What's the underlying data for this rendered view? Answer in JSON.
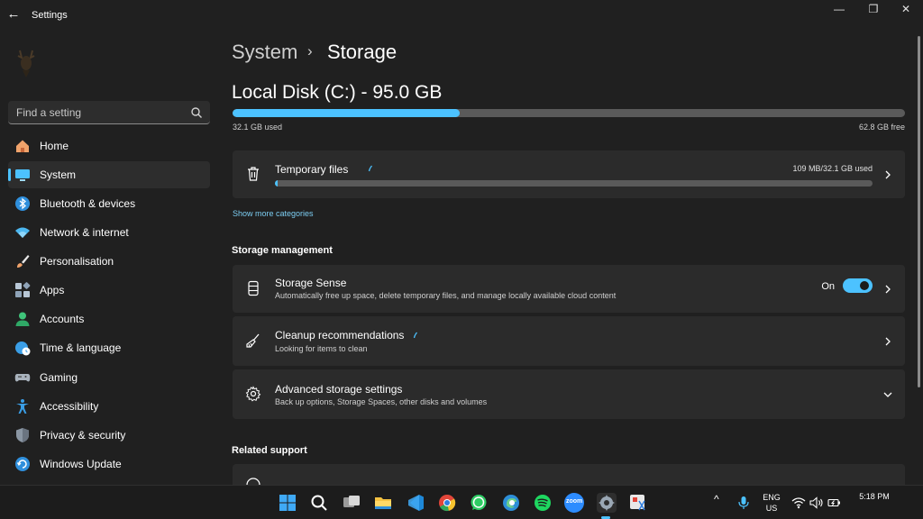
{
  "window": {
    "title": "Settings",
    "back_glyph": "←",
    "min_glyph": "—",
    "restore_glyph": "❐",
    "close_glyph": "✕"
  },
  "sidebar": {
    "search_placeholder": "Find a setting",
    "items": [
      {
        "label": "Home",
        "icon": "home-icon",
        "active": false
      },
      {
        "label": "System",
        "icon": "system-icon",
        "active": true
      },
      {
        "label": "Bluetooth & devices",
        "icon": "bluetooth-icon",
        "active": false
      },
      {
        "label": "Network & internet",
        "icon": "wifi-icon",
        "active": false
      },
      {
        "label": "Personalisation",
        "icon": "brush-icon",
        "active": false
      },
      {
        "label": "Apps",
        "icon": "apps-icon",
        "active": false
      },
      {
        "label": "Accounts",
        "icon": "accounts-icon",
        "active": false
      },
      {
        "label": "Time & language",
        "icon": "globe-clock-icon",
        "active": false
      },
      {
        "label": "Gaming",
        "icon": "gamepad-icon",
        "active": false
      },
      {
        "label": "Accessibility",
        "icon": "accessibility-icon",
        "active": false
      },
      {
        "label": "Privacy & security",
        "icon": "shield-icon",
        "active": false
      },
      {
        "label": "Windows Update",
        "icon": "update-icon",
        "active": false
      }
    ]
  },
  "breadcrumb": {
    "parent": "System",
    "separator": "›",
    "current": "Storage"
  },
  "disk": {
    "title": "Local Disk (C:) - 95.0 GB",
    "used_label": "32.1 GB used",
    "free_label": "62.8 GB free",
    "used_fraction": 0.338
  },
  "temp_files": {
    "title": "Temporary files",
    "size_label": "109 MB/32.1 GB used",
    "used_fraction": 0.004
  },
  "show_more_link": "Show more categories",
  "storage_management": {
    "heading": "Storage management",
    "storage_sense": {
      "title": "Storage Sense",
      "subtitle": "Automatically free up space, delete temporary files, and manage locally available cloud content",
      "toggle_label": "On",
      "toggle_on": true
    },
    "cleanup": {
      "title": "Cleanup recommendations",
      "subtitle": "Looking for items to clean"
    },
    "advanced": {
      "title": "Advanced storage settings",
      "subtitle": "Back up options, Storage Spaces, other disks and volumes"
    }
  },
  "related_support": {
    "heading": "Related support"
  },
  "taskbar": {
    "apps": [
      "windows-start-icon",
      "search-icon",
      "task-view-icon",
      "file-explorer-icon",
      "vscode-icon",
      "chrome-icon",
      "whatsapp-icon",
      "edge-icon",
      "spotify-icon",
      "zoom-icon",
      "settings-icon",
      "snipping-tool-icon"
    ],
    "zoom_label": "zoom",
    "lang_top": "ENG",
    "lang_bottom": "US",
    "time": "5:18 PM",
    "chevron_glyph": "^"
  },
  "colors": {
    "accent": "#4cc2ff",
    "background": "#202020",
    "card": "#2b2b2b"
  }
}
